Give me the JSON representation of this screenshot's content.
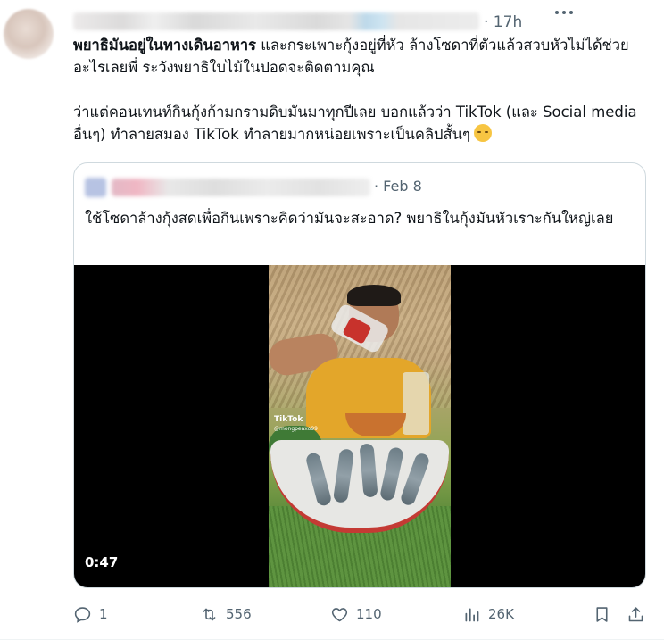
{
  "tweet": {
    "time": "· 17h",
    "paragraph1_bold": "พยาธิมันอยู่ในทางเดินอาหาร",
    "paragraph1_rest": " และกระเพาะกุ้งอยู่ที่หัว ล้างโซดาที่ตัวแล้วสวบหัวไม่ได้ช่วยอะไรเลยพี่ ระวังพยาธิใบไม้ในปอดจะติดตามคุณ",
    "paragraph2": "ว่าแต่คอนเทนท์กินกุ้งก้ามกรามดิบมันมาทุกปีเลย บอกแล้วว่า TikTok (และ Social media อื่นๆ) ทำลายสมอง TikTok ทำลายมากหน่อยเพราะเป็นคลิปสั้นๆ"
  },
  "quote": {
    "date": "· Feb 8",
    "text": "ใช้โซดาล้างกุ้งสดเพื่อกินเพราะคิดว่ามันจะสะอาด?  พยาธิในกุ้งมันหัวเราะกันใหญ่เลย",
    "video": {
      "duration": "0:47",
      "watermark": "TikTok",
      "watermark_handle": "@mongpeaxo99"
    }
  },
  "actions": {
    "replies": "1",
    "retweets": "556",
    "likes": "110",
    "views": "26K"
  },
  "icons": [
    "more-icon",
    "reply-icon",
    "retweet-icon",
    "like-icon",
    "views-icon",
    "bookmark-icon",
    "share-icon"
  ],
  "colors": {
    "muted": "#536471",
    "text": "#0f1419",
    "border": "#cfd9de"
  }
}
